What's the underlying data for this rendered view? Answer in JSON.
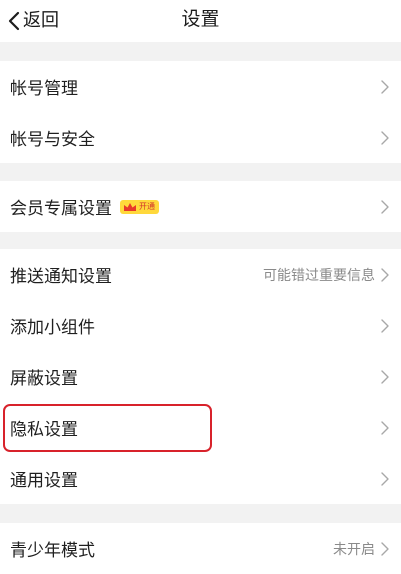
{
  "header": {
    "back_label": "返回",
    "title": "设置"
  },
  "groups": [
    {
      "rows": [
        {
          "label": "帐号管理"
        },
        {
          "label": "帐号与安全"
        }
      ]
    },
    {
      "rows": [
        {
          "label": "会员专属设置",
          "badge": "开通"
        }
      ]
    },
    {
      "rows": [
        {
          "label": "推送通知设置",
          "value": "可能错过重要信息"
        },
        {
          "label": "添加小组件"
        },
        {
          "label": "屏蔽设置"
        },
        {
          "label": "隐私设置",
          "highlighted": true
        },
        {
          "label": "通用设置"
        }
      ]
    },
    {
      "rows": [
        {
          "label": "青少年模式",
          "value": "未开启"
        }
      ]
    }
  ],
  "colors": {
    "background": "#f2f2f2",
    "surface": "#ffffff",
    "highlight_border": "#d8222b",
    "vip_badge": "#ffd83b",
    "secondary_text": "#8a8a8a"
  },
  "icons": {
    "back": "chevron-left-icon",
    "row_arrow": "chevron-right-icon",
    "vip": "crown-icon"
  }
}
